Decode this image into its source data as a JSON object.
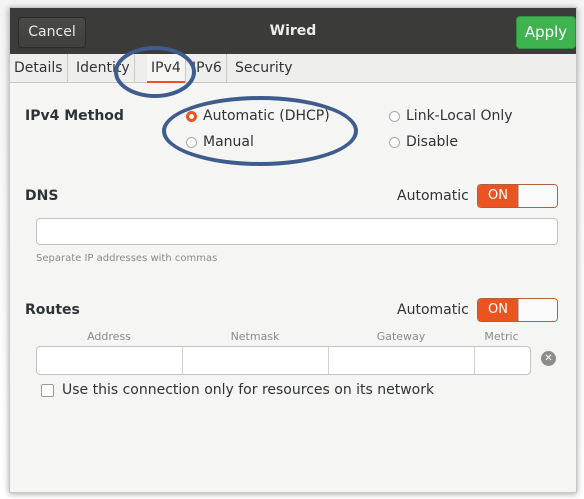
{
  "window": {
    "title": "Wired",
    "cancel_label": "Cancel",
    "apply_label": "Apply"
  },
  "tabs": [
    {
      "label": "Details"
    },
    {
      "label": "Identity"
    },
    {
      "label": "IPv4",
      "active": true
    },
    {
      "label": "IPv6"
    },
    {
      "label": "Security"
    }
  ],
  "ipv4": {
    "method_label": "IPv4 Method",
    "options": [
      {
        "label": "Automatic (DHCP)",
        "selected": true
      },
      {
        "label": "Link-Local Only",
        "selected": false
      },
      {
        "label": "Manual",
        "selected": false
      },
      {
        "label": "Disable",
        "selected": false
      }
    ]
  },
  "dns": {
    "label": "DNS",
    "automatic_label": "Automatic",
    "toggle_state": "ON",
    "input_value": "",
    "hint": "Separate IP addresses with commas"
  },
  "routes": {
    "label": "Routes",
    "automatic_label": "Automatic",
    "toggle_state": "ON",
    "columns": [
      "Address",
      "Netmask",
      "Gateway",
      "Metric"
    ]
  },
  "checkbox": {
    "label": "Use this connection only for resources on its network",
    "checked": false
  },
  "icons": {
    "clear": "clear-icon"
  },
  "colors": {
    "accent": "#e95420",
    "apply": "#3eb34f",
    "titlebar": "#3b3b39",
    "annotation": "#3e5c8c"
  }
}
